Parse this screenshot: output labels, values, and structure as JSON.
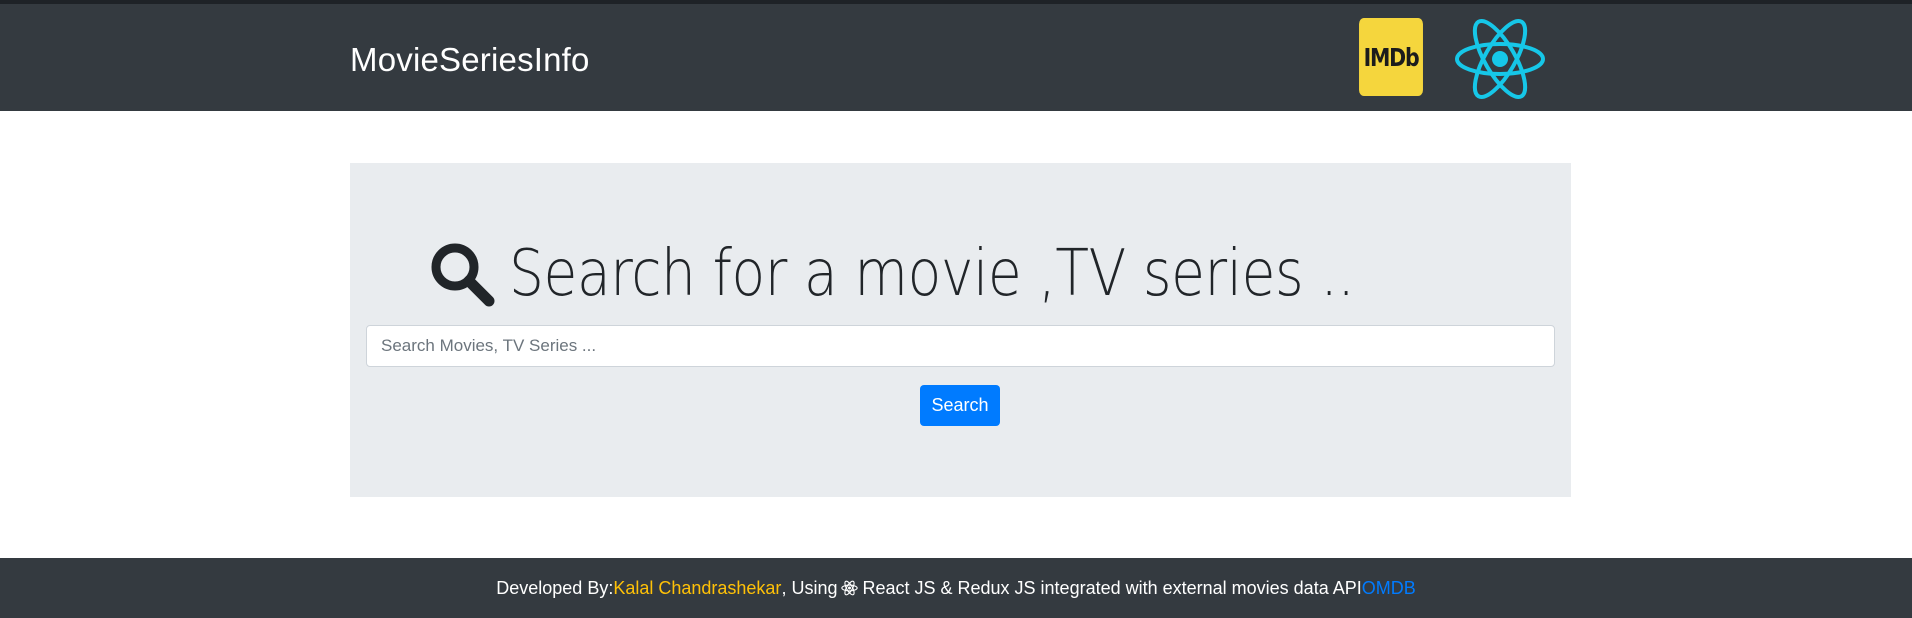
{
  "navbar": {
    "brand": "MovieSeriesInfo",
    "imdb_logo_text": "IMDb",
    "react_logo": "react-atom-icon"
  },
  "hero": {
    "icon": "search-icon",
    "title": "Search for a movie ,TV series ..",
    "search_placeholder": "Search Movies, TV Series ...",
    "search_value": "",
    "search_button_label": "Search"
  },
  "footer": {
    "prefix": "Developed By:",
    "author": "Kalal Chandrashekar",
    "middle_before_icon": ", Using",
    "icon": "react-atom-icon",
    "middle_after_icon": "React JS & Redux JS integrated with external movies data API",
    "api_name": "OMDB"
  },
  "colors": {
    "navbar_bg": "#343a40",
    "jumbotron_bg": "#e9ecef",
    "primary": "#007bff",
    "author_link": "#ffc107",
    "imdb_yellow": "#f5d63d",
    "react_cyan": "#16c7e8"
  }
}
